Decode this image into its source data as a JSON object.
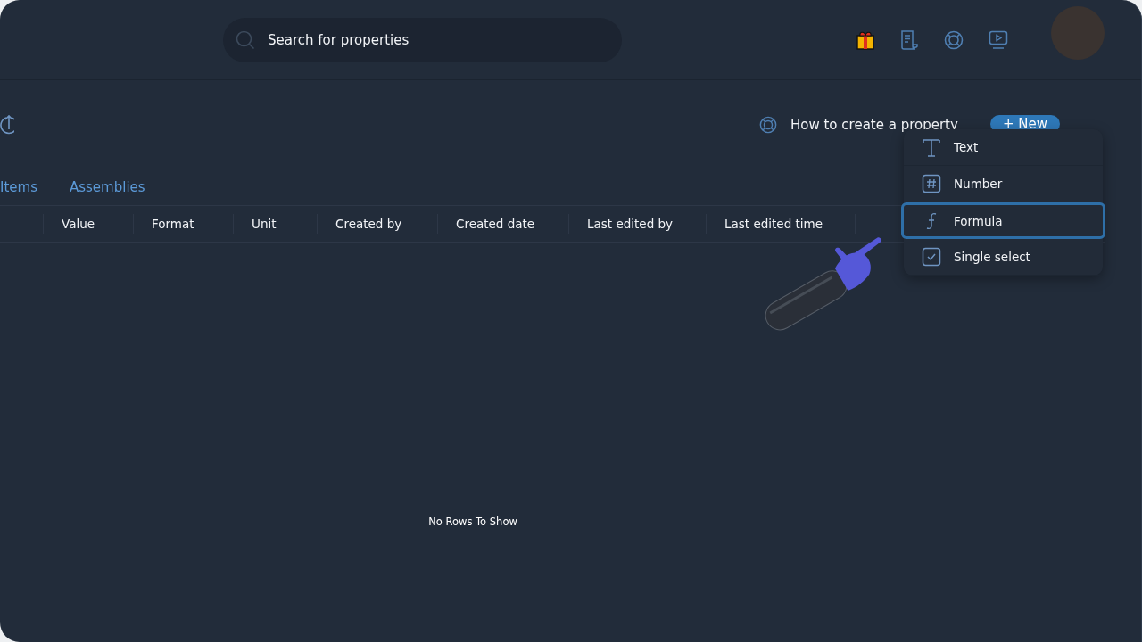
{
  "search": {
    "placeholder": "Search for properties"
  },
  "toolbar": {
    "help_link": "How to create a property",
    "new_button": "+ New"
  },
  "tabs": [
    {
      "label": "Items"
    },
    {
      "label": "Assemblies"
    }
  ],
  "table": {
    "columns": [
      "Value",
      "Format",
      "Unit",
      "Created by",
      "Created date",
      "Last edited by",
      "Last edited time"
    ],
    "empty_message": "No Rows To Show"
  },
  "new_menu": [
    {
      "kind": "text",
      "label": "Text",
      "selected": false
    },
    {
      "kind": "number",
      "label": "Number",
      "selected": false
    },
    {
      "kind": "formula",
      "label": "Formula",
      "selected": true
    },
    {
      "kind": "select",
      "label": "Single select",
      "selected": false
    }
  ]
}
